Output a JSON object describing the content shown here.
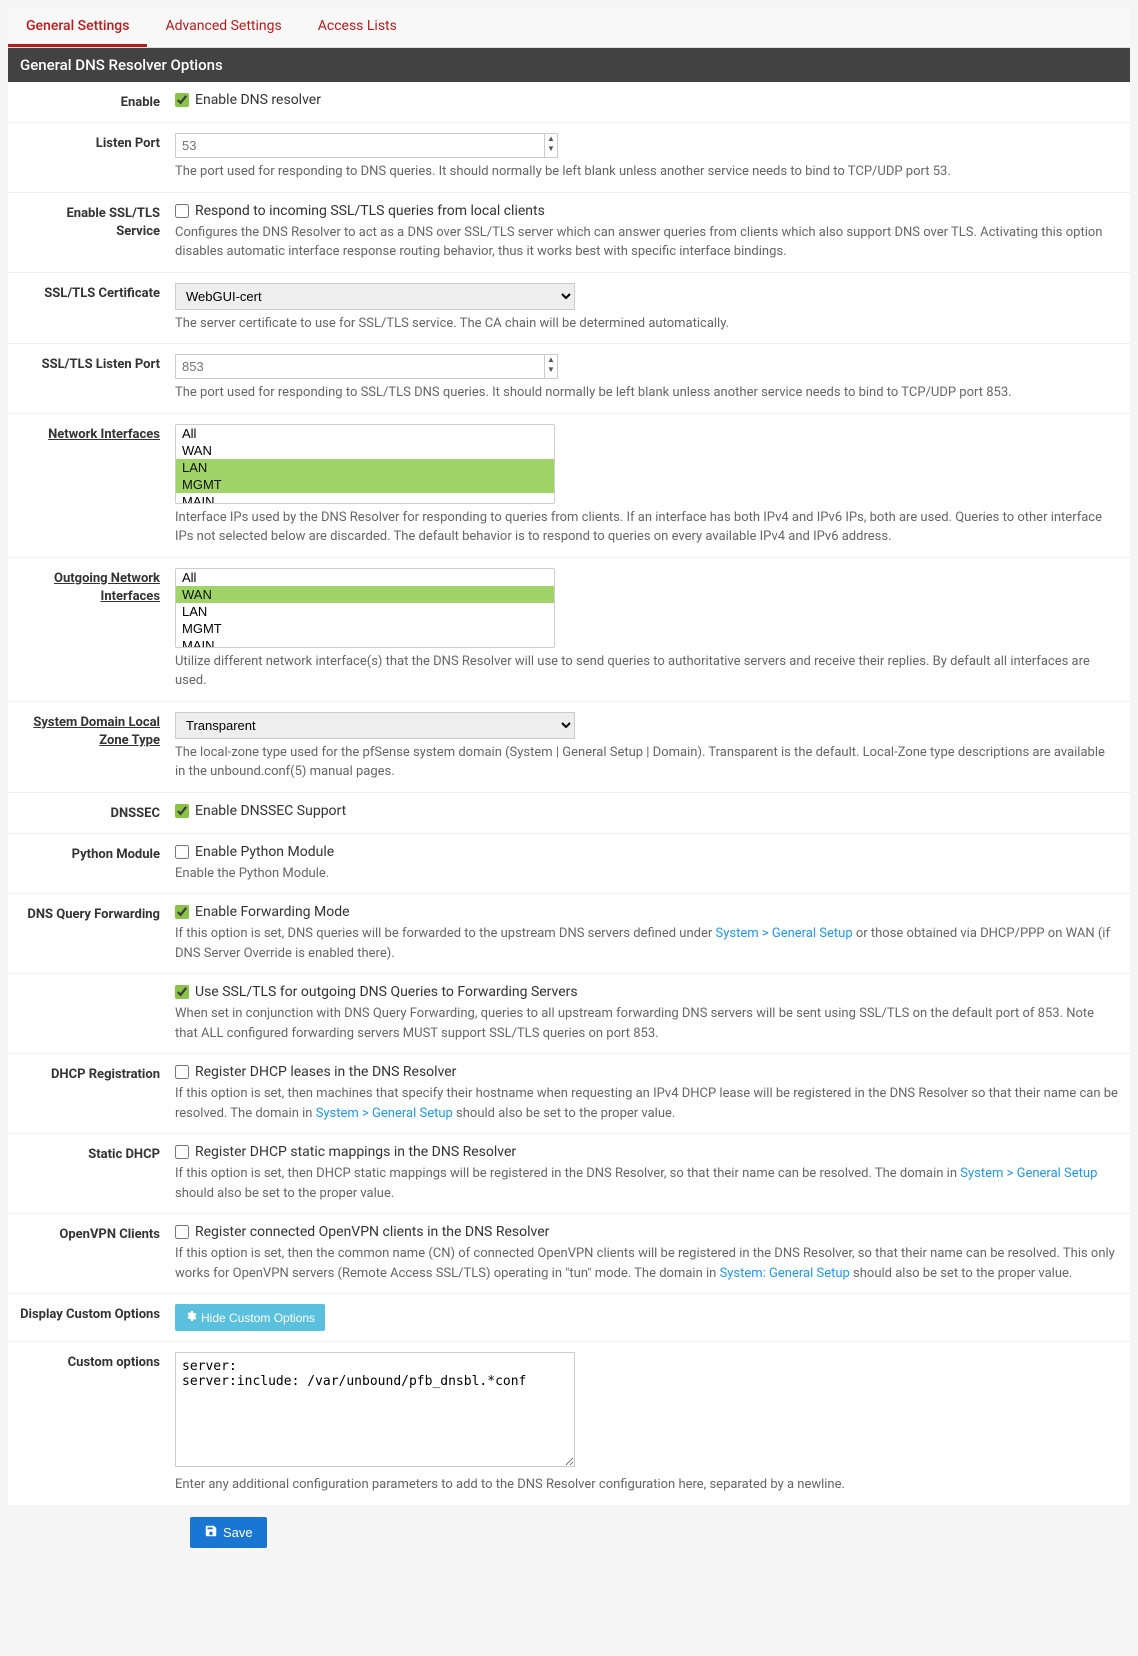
{
  "tabs": {
    "general": "General Settings",
    "advanced": "Advanced Settings",
    "access": "Access Lists"
  },
  "panel_title": "General DNS Resolver Options",
  "enable": {
    "label": "Enable",
    "checkbox": "Enable DNS resolver"
  },
  "listen_port": {
    "label": "Listen Port",
    "placeholder": "53",
    "help": "The port used for responding to DNS queries. It should normally be left blank unless another service needs to bind to TCP/UDP port 53."
  },
  "ssl_service": {
    "label": "Enable SSL/TLS Service",
    "checkbox": "Respond to incoming SSL/TLS queries from local clients",
    "help": "Configures the DNS Resolver to act as a DNS over SSL/TLS server which can answer queries from clients which also support DNS over TLS. Activating this option disables automatic interface response routing behavior, thus it works best with specific interface bindings."
  },
  "ssl_cert": {
    "label": "SSL/TLS Certificate",
    "value": "WebGUI-cert",
    "help": "The server certificate to use for SSL/TLS service. The CA chain will be determined automatically."
  },
  "ssl_port": {
    "label": "SSL/TLS Listen Port",
    "placeholder": "853",
    "help": "The port used for responding to SSL/TLS DNS queries. It should normally be left blank unless another service needs to bind to TCP/UDP port 853."
  },
  "net_if": {
    "label": "Network Interfaces",
    "options": [
      "All",
      "WAN",
      "LAN",
      "MGMT",
      "MAIN"
    ],
    "help": "Interface IPs used by the DNS Resolver for responding to queries from clients. If an interface has both IPv4 and IPv6 IPs, both are used. Queries to other interface IPs not selected below are discarded. The default behavior is to respond to queries on every available IPv4 and IPv6 address."
  },
  "out_if": {
    "label": "Outgoing Network Interfaces",
    "options": [
      "All",
      "WAN",
      "LAN",
      "MGMT",
      "MAIN"
    ],
    "help": "Utilize different network interface(s) that the DNS Resolver will use to send queries to authoritative servers and receive their replies. By default all interfaces are used."
  },
  "zone_type": {
    "label": "System Domain Local Zone Type",
    "value": "Transparent",
    "help": "The local-zone type used for the pfSense system domain (System | General Setup | Domain). Transparent is the default. Local-Zone type descriptions are available in the unbound.conf(5) manual pages."
  },
  "dnssec": {
    "label": "DNSSEC",
    "checkbox": "Enable DNSSEC Support"
  },
  "python": {
    "label": "Python Module",
    "checkbox": "Enable Python Module",
    "help": "Enable the Python Module."
  },
  "fwd": {
    "label": "DNS Query Forwarding",
    "checkbox": "Enable Forwarding Mode",
    "help_a": "If this option is set, DNS queries will be forwarded to the upstream DNS servers defined under ",
    "help_link": "System > General Setup",
    "help_b": " or those obtained via DHCP/PPP on WAN (if DNS Server Override is enabled there).",
    "ssl_checkbox": "Use SSL/TLS for outgoing DNS Queries to Forwarding Servers",
    "ssl_help": "When set in conjunction with DNS Query Forwarding, queries to all upstream forwarding DNS servers will be sent using SSL/TLS on the default port of 853. Note that ALL configured forwarding servers MUST support SSL/TLS queries on port 853."
  },
  "dhcp_reg": {
    "label": "DHCP Registration",
    "checkbox": "Register DHCP leases in the DNS Resolver",
    "help_a": "If this option is set, then machines that specify their hostname when requesting an IPv4 DHCP lease will be registered in the DNS Resolver so that their name can be resolved. The domain in ",
    "help_link": "System > General Setup",
    "help_b": " should also be set to the proper value."
  },
  "static_dhcp": {
    "label": "Static DHCP",
    "checkbox": "Register DHCP static mappings in the DNS Resolver",
    "help_a": "If this option is set, then DHCP static mappings will be registered in the DNS Resolver, so that their name can be resolved. The domain in ",
    "help_link": "System > General Setup",
    "help_b": " should also be set to the proper value."
  },
  "ovpn": {
    "label": "OpenVPN Clients",
    "checkbox": "Register connected OpenVPN clients in the DNS Resolver",
    "help_a": "If this option is set, then the common name (CN) of connected OpenVPN clients will be registered in the DNS Resolver, so that their name can be resolved. This only works for OpenVPN servers (Remote Access SSL/TLS) operating in \"tun\" mode. The domain in ",
    "help_link": "System: General Setup",
    "help_b": " should also be set to the proper value."
  },
  "custom_display": {
    "label": "Display Custom Options",
    "button": "Hide Custom Options"
  },
  "custom_opts": {
    "label": "Custom options",
    "value": "server:\nserver:include: /var/unbound/pfb_dnsbl.*conf",
    "help": "Enter any additional configuration parameters to add to the DNS Resolver configuration here, separated by a newline."
  },
  "save": "Save"
}
